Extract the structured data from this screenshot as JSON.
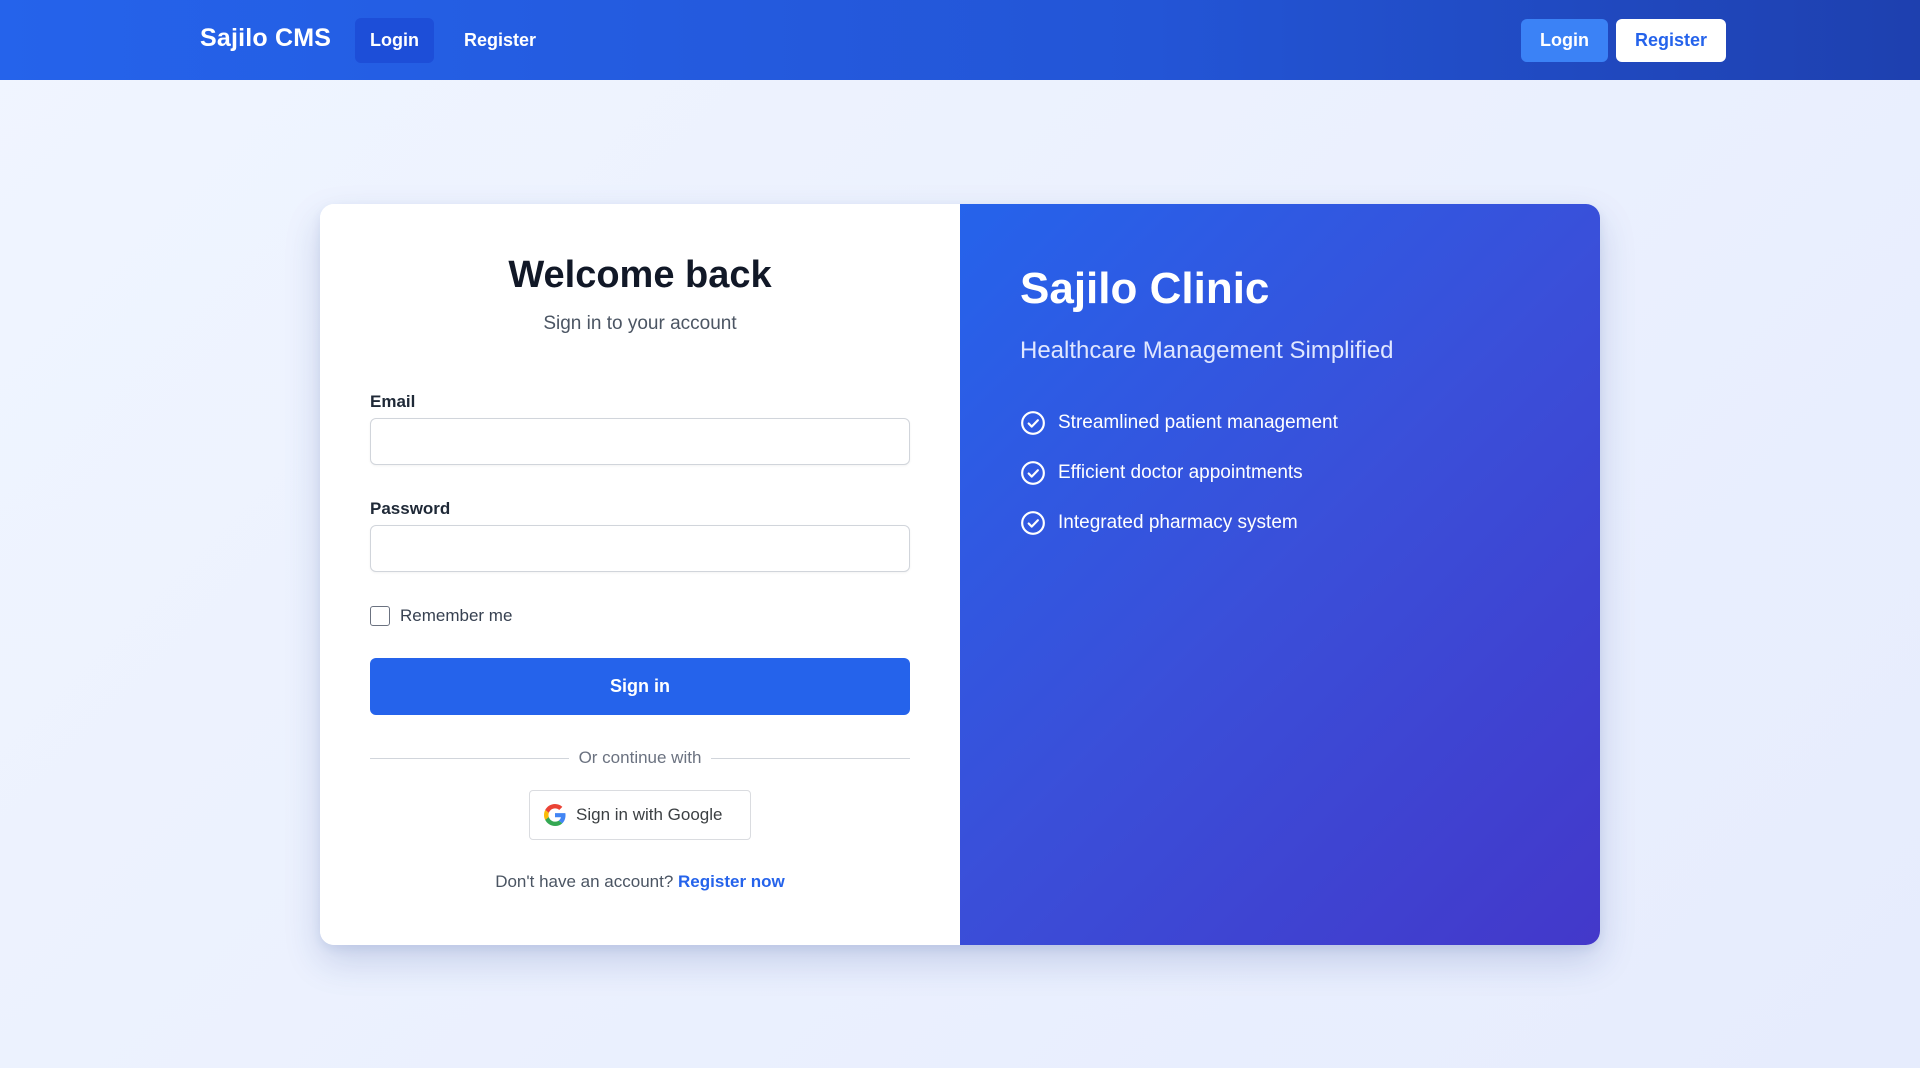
{
  "navbar": {
    "brand": "Sajilo CMS",
    "links": [
      {
        "label": "Login",
        "active": true
      },
      {
        "label": "Register",
        "active": false
      }
    ],
    "buttons": {
      "login": "Login",
      "register": "Register"
    }
  },
  "login_form": {
    "title": "Welcome back",
    "subtitle": "Sign in to your account",
    "email": {
      "label": "Email",
      "value": "",
      "placeholder": ""
    },
    "password": {
      "label": "Password",
      "value": "",
      "placeholder": ""
    },
    "remember_me": {
      "label": "Remember me",
      "checked": false
    },
    "submit_label": "Sign in",
    "divider_text": "Or continue with",
    "google_button": {
      "label": "Sign in with Google",
      "icon": "google-logo-icon"
    },
    "footer": {
      "prompt": "Don't have an account?",
      "link_label": "Register now"
    }
  },
  "promo": {
    "title": "Sajilo Clinic",
    "subtitle": "Healthcare Management Simplified",
    "features": [
      {
        "label": "Streamlined patient management",
        "icon": "check-circle-icon"
      },
      {
        "label": "Efficient doctor appointments",
        "icon": "check-circle-icon"
      },
      {
        "label": "Integrated pharmacy system",
        "icon": "check-circle-icon"
      }
    ]
  },
  "colors": {
    "primary": "#2563eb",
    "primary_dark": "#1d4ed8",
    "promo_gradient_end": "#4338ca",
    "background": "#eef2fd"
  }
}
